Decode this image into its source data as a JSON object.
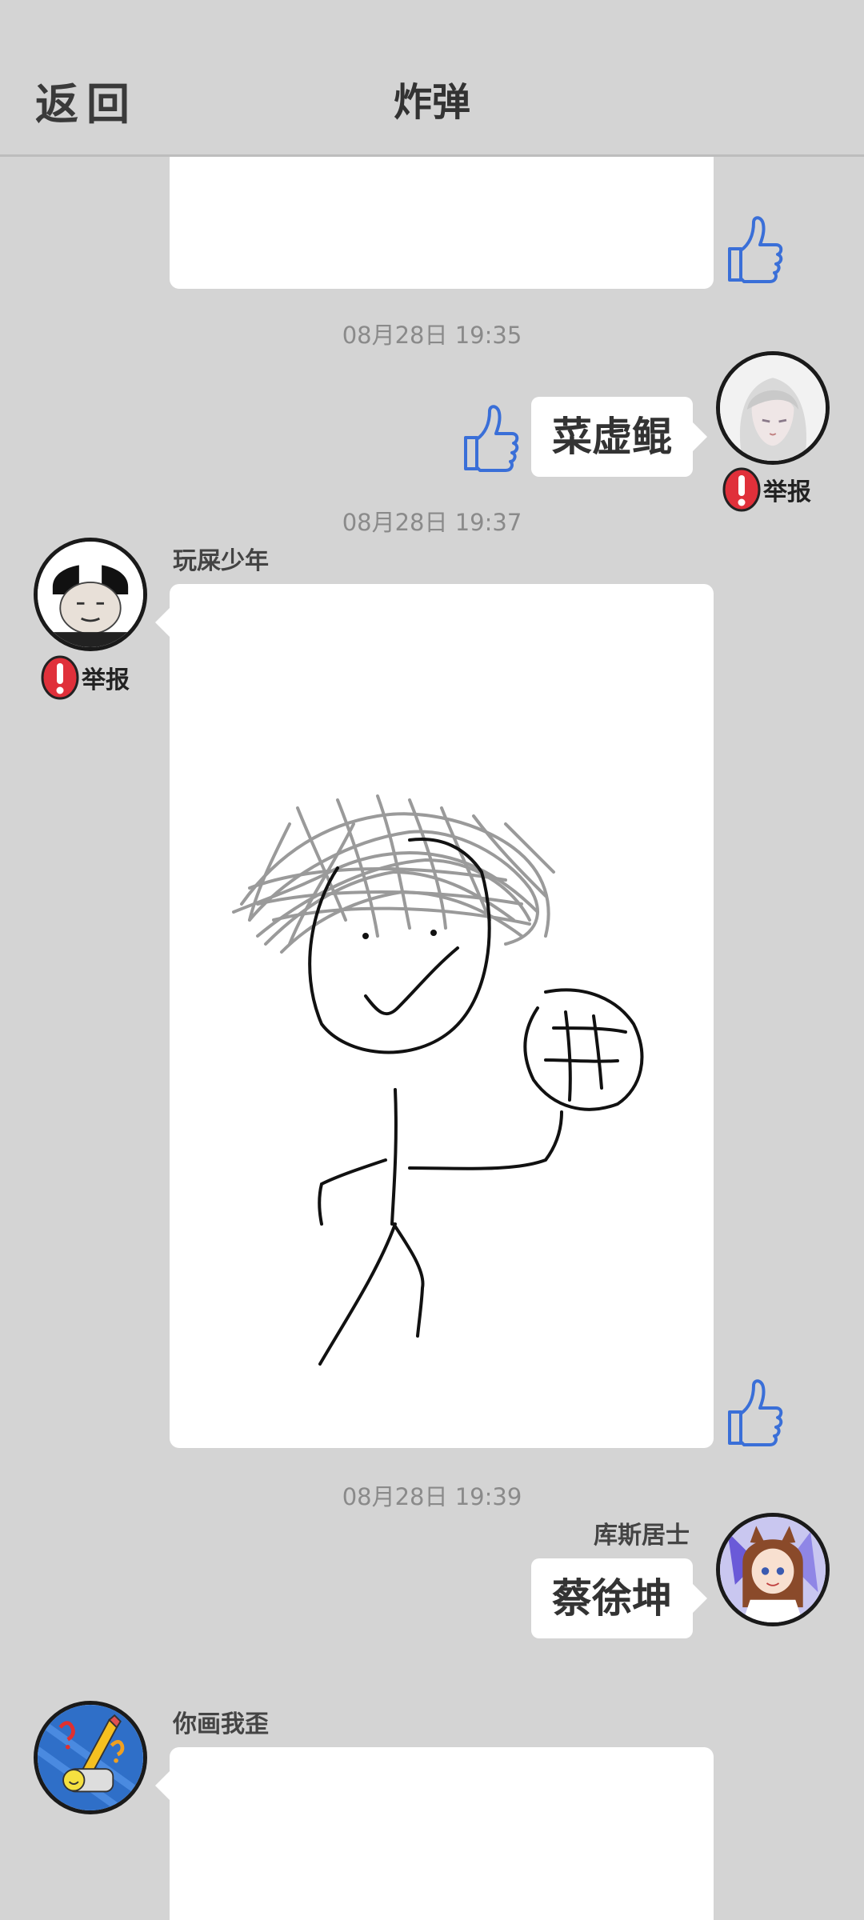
{
  "header": {
    "back_label": "返回",
    "title": "炸弹"
  },
  "messages": [
    {
      "timestamp": "08月28日 19:35",
      "text": "菜虚鲲",
      "report_label": "举报"
    },
    {
      "timestamp": "08月28日 19:37",
      "sender": "玩屎少年",
      "report_label": "举报"
    },
    {
      "timestamp": "08月28日 19:39",
      "sender": "库斯居士",
      "text": "蔡徐坤"
    },
    {
      "sender": "你画我歪"
    }
  ],
  "icons": {
    "like": "thumbs-up-icon",
    "report": "exclamation-icon"
  },
  "colors": {
    "background": "#d4d4d4",
    "like_blue": "#3a6fd8",
    "report_red": "#e0303a"
  }
}
